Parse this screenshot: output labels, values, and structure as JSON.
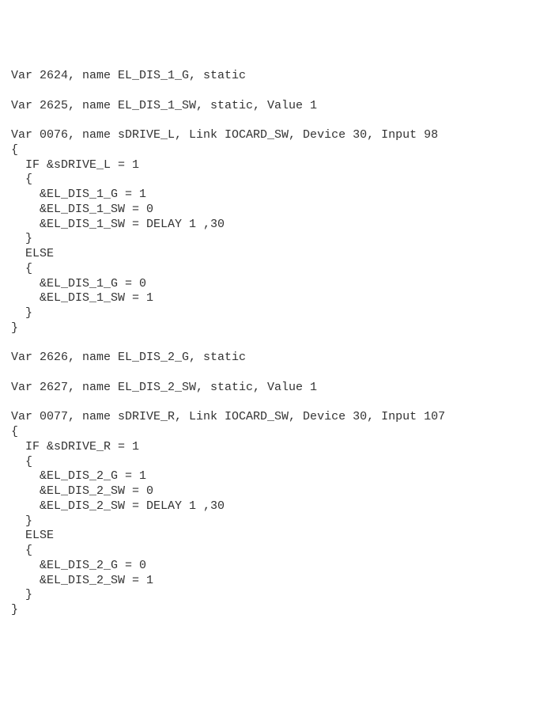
{
  "lines": [
    "Var 2624, name EL_DIS_1_G, static",
    "",
    "Var 2625, name EL_DIS_1_SW, static, Value 1",
    "",
    "Var 0076, name sDRIVE_L, Link IOCARD_SW, Device 30, Input 98",
    "{",
    "  IF &sDRIVE_L = 1",
    "  {",
    "    &EL_DIS_1_G = 1",
    "    &EL_DIS_1_SW = 0",
    "    &EL_DIS_1_SW = DELAY 1 ,30",
    "  }",
    "  ELSE",
    "  {",
    "    &EL_DIS_1_G = 0",
    "    &EL_DIS_1_SW = 1",
    "  }",
    "}",
    "",
    "Var 2626, name EL_DIS_2_G, static",
    "",
    "Var 2627, name EL_DIS_2_SW, static, Value 1",
    "",
    "Var 0077, name sDRIVE_R, Link IOCARD_SW, Device 30, Input 107",
    "{",
    "  IF &sDRIVE_R = 1",
    "  {",
    "    &EL_DIS_2_G = 1",
    "    &EL_DIS_2_SW = 0",
    "    &EL_DIS_2_SW = DELAY 1 ,30",
    "  }",
    "  ELSE",
    "  {",
    "    &EL_DIS_2_G = 0",
    "    &EL_DIS_2_SW = 1",
    "  }",
    "}"
  ]
}
